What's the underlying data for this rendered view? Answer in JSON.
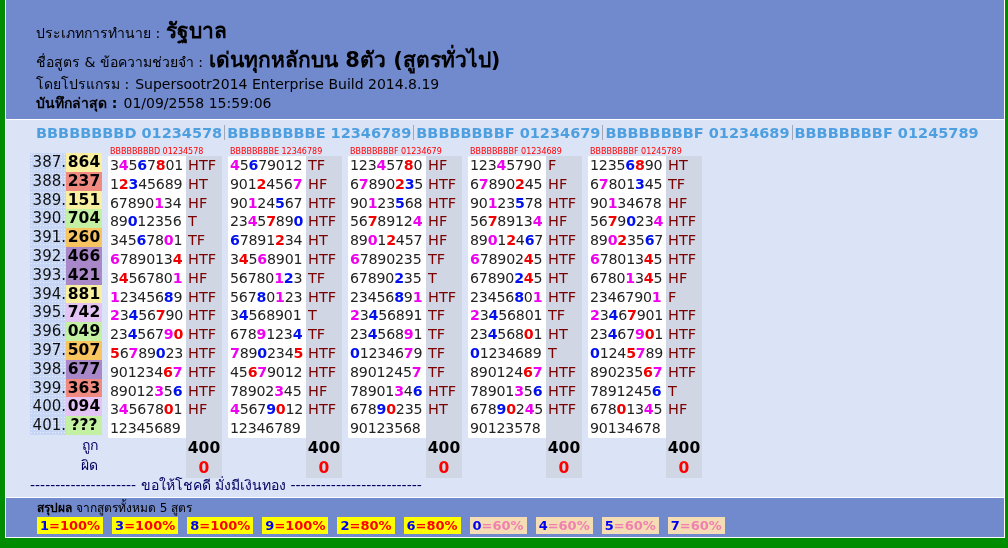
{
  "header": {
    "type_label": "ประเภทการทำนาย :",
    "type_value": "รัฐบาล",
    "formula_label": "ชื่อสูตร & ข้อความช่วยจำ :",
    "formula_value": "เด่นทุกหลักบน 8ตัว (สูตรทั่วไป)",
    "program_label": "โดยโปรแกรม :",
    "program_value": "Supersootr2014 Enterprise Build 2014.8.19",
    "saved_label": "บันทึกล่าสุด :",
    "saved_value": "01/09/2558 15:59:06"
  },
  "formula_bar": [
    "BBBBBBBBD 01234578",
    "BBBBBBBBE 12346789",
    "BBBBBBBBF 01234679",
    "BBBBBBBBF 01234689",
    "BBBBBBBBF 01245789"
  ],
  "draws": [
    {
      "index": "387.",
      "result": "864",
      "color": "#f8f0a0"
    },
    {
      "index": "388.",
      "result": "237",
      "color": "#f08a80"
    },
    {
      "index": "389.",
      "result": "151",
      "color": "#f8f0a0"
    },
    {
      "index": "390.",
      "result": "704",
      "color": "#c4f0a4"
    },
    {
      "index": "391.",
      "result": "260",
      "color": "#f8c460"
    },
    {
      "index": "392.",
      "result": "466",
      "color": "#a888c8"
    },
    {
      "index": "393.",
      "result": "421",
      "color": "#a888c8"
    },
    {
      "index": "394.",
      "result": "881",
      "color": "#f8f0a0"
    },
    {
      "index": "395.",
      "result": "742",
      "color": "#e4c4f4"
    },
    {
      "index": "396.",
      "result": "049",
      "color": "#c4f0a4"
    },
    {
      "index": "397.",
      "result": "507",
      "color": "#f8c460"
    },
    {
      "index": "398.",
      "result": "677",
      "color": "#a888c8"
    },
    {
      "index": "399.",
      "result": "363",
      "color": "#f08a80"
    },
    {
      "index": "400.",
      "result": "094",
      "color": "#e4c4f4"
    },
    {
      "index": "401.",
      "result": "???",
      "color": "#c4f0a4"
    }
  ],
  "columns": [
    {
      "title": "BBBBBBBBD 01234578",
      "correct": "400",
      "wrong": "0",
      "cells": [
        {
          "digits": "34567801",
          "hits": "HTF"
        },
        {
          "digits": "12345689",
          "hits": "HT"
        },
        {
          "digits": "67890134",
          "hits": "HF"
        },
        {
          "digits": "89012356",
          "hits": "T"
        },
        {
          "digits": "34567801",
          "hits": "TF"
        },
        {
          "digits": "67890134",
          "hits": "HTF"
        },
        {
          "digits": "34567801",
          "hits": "HF"
        },
        {
          "digits": "12345689",
          "hits": "HTF"
        },
        {
          "digits": "23456790",
          "hits": "HTF"
        },
        {
          "digits": "23456790",
          "hits": "HTF"
        },
        {
          "digits": "56789023",
          "hits": "HTF"
        },
        {
          "digits": "90123467",
          "hits": "HTF"
        },
        {
          "digits": "89012356",
          "hits": "HTF"
        },
        {
          "digits": "34567801",
          "hits": "HF"
        },
        {
          "digits": "12345689"
        }
      ]
    },
    {
      "title": "BBBBBBBBE 12346789",
      "correct": "400",
      "wrong": "0",
      "cells": [
        {
          "digits": "45679012",
          "hits": "TF"
        },
        {
          "digits": "90124567",
          "hits": "HF"
        },
        {
          "digits": "90124567",
          "hits": "HTF"
        },
        {
          "digits": "23457890",
          "hits": "HTF"
        },
        {
          "digits": "67891234",
          "hits": "HT"
        },
        {
          "digits": "34568901",
          "hits": "HTF"
        },
        {
          "digits": "56780123",
          "hits": "TF"
        },
        {
          "digits": "56780123",
          "hits": "HTF"
        },
        {
          "digits": "34568901",
          "hits": "T"
        },
        {
          "digits": "67891234",
          "hits": "TF"
        },
        {
          "digits": "78902345",
          "hits": "HTF"
        },
        {
          "digits": "45679012",
          "hits": "HTF"
        },
        {
          "digits": "78902345",
          "hits": "HF"
        },
        {
          "digits": "45679012",
          "hits": "HTF"
        },
        {
          "digits": "12346789"
        }
      ]
    },
    {
      "title": "BBBBBBBBF 01234679",
      "correct": "400",
      "wrong": "0",
      "cells": [
        {
          "digits": "12345780",
          "hits": "HF"
        },
        {
          "digits": "67890235",
          "hits": "HTF"
        },
        {
          "digits": "90123568",
          "hits": "HTF"
        },
        {
          "digits": "56789124",
          "hits": "HF"
        },
        {
          "digits": "89012457",
          "hits": "HF"
        },
        {
          "digits": "67890235",
          "hits": "TF"
        },
        {
          "digits": "67890235",
          "hits": "T"
        },
        {
          "digits": "23456891",
          "hits": "HTF"
        },
        {
          "digits": "23456891",
          "hits": "TF"
        },
        {
          "digits": "23456891",
          "hits": "TF"
        },
        {
          "digits": "01234679",
          "hits": "TF"
        },
        {
          "digits": "89012457",
          "hits": "TF"
        },
        {
          "digits": "78901346",
          "hits": "HTF"
        },
        {
          "digits": "67890235",
          "hits": "HT"
        },
        {
          "digits": "90123568"
        }
      ]
    },
    {
      "title": "BBBBBBBBF 01234689",
      "correct": "400",
      "wrong": "0",
      "cells": [
        {
          "digits": "12345790",
          "hits": "F"
        },
        {
          "digits": "67890245",
          "hits": "HF"
        },
        {
          "digits": "90123578",
          "hits": "HTF"
        },
        {
          "digits": "56789134",
          "hits": "HF"
        },
        {
          "digits": "89012467",
          "hits": "HTF"
        },
        {
          "digits": "67890245",
          "hits": "HTF"
        },
        {
          "digits": "67890245",
          "hits": "HT"
        },
        {
          "digits": "23456801",
          "hits": "HTF"
        },
        {
          "digits": "23456801",
          "hits": "TF"
        },
        {
          "digits": "23456801",
          "hits": "HT"
        },
        {
          "digits": "01234689",
          "hits": "T"
        },
        {
          "digits": "89012467",
          "hits": "HTF"
        },
        {
          "digits": "78901356",
          "hits": "HTF"
        },
        {
          "digits": "67890245",
          "hits": "HTF"
        },
        {
          "digits": "90123578"
        }
      ]
    },
    {
      "title": "BBBBBBBBF 01245789",
      "correct": "400",
      "wrong": "0",
      "cells": [
        {
          "digits": "12356890",
          "hits": "HT"
        },
        {
          "digits": "67801345",
          "hits": "TF"
        },
        {
          "digits": "90134678",
          "hits": "HF"
        },
        {
          "digits": "56790234",
          "hits": "HTF"
        },
        {
          "digits": "89023567",
          "hits": "HTF"
        },
        {
          "digits": "67801345",
          "hits": "HTF"
        },
        {
          "digits": "67801345",
          "hits": "HF"
        },
        {
          "digits": "23467901",
          "hits": "F"
        },
        {
          "digits": "23467901",
          "hits": "HTF"
        },
        {
          "digits": "23467901",
          "hits": "HTF"
        },
        {
          "digits": "01245789",
          "hits": "HTF"
        },
        {
          "digits": "89023567",
          "hits": "HTF"
        },
        {
          "digits": "78912456",
          "hits": "T"
        },
        {
          "digits": "67801345",
          "hits": "HF"
        },
        {
          "digits": "90134678"
        }
      ]
    }
  ],
  "totals_labels": {
    "correct": "ถูก",
    "wrong": "ผิด"
  },
  "footer_message": "--------------------- ขอให้โชคดี มั่งมีเงินทอง --------------------------",
  "summary": {
    "label": "สรุปผล",
    "text": "จากสูตรทั้งหมด 5 สูตร",
    "chips": [
      {
        "digit": "1",
        "rate": "=100%",
        "kind": "high"
      },
      {
        "digit": "3",
        "rate": "=100%",
        "kind": "high"
      },
      {
        "digit": "8",
        "rate": "=100%",
        "kind": "high"
      },
      {
        "digit": "9",
        "rate": "=100%",
        "kind": "high"
      },
      {
        "digit": "2",
        "rate": "=80%",
        "kind": "high"
      },
      {
        "digit": "6",
        "rate": "=80%",
        "kind": "high"
      },
      {
        "digit": "0",
        "rate": "=60%",
        "kind": "low"
      },
      {
        "digit": "4",
        "rate": "=60%",
        "kind": "low"
      },
      {
        "digit": "5",
        "rate": "=60%",
        "kind": "low"
      },
      {
        "digit": "7",
        "rate": "=60%",
        "kind": "low"
      }
    ]
  }
}
